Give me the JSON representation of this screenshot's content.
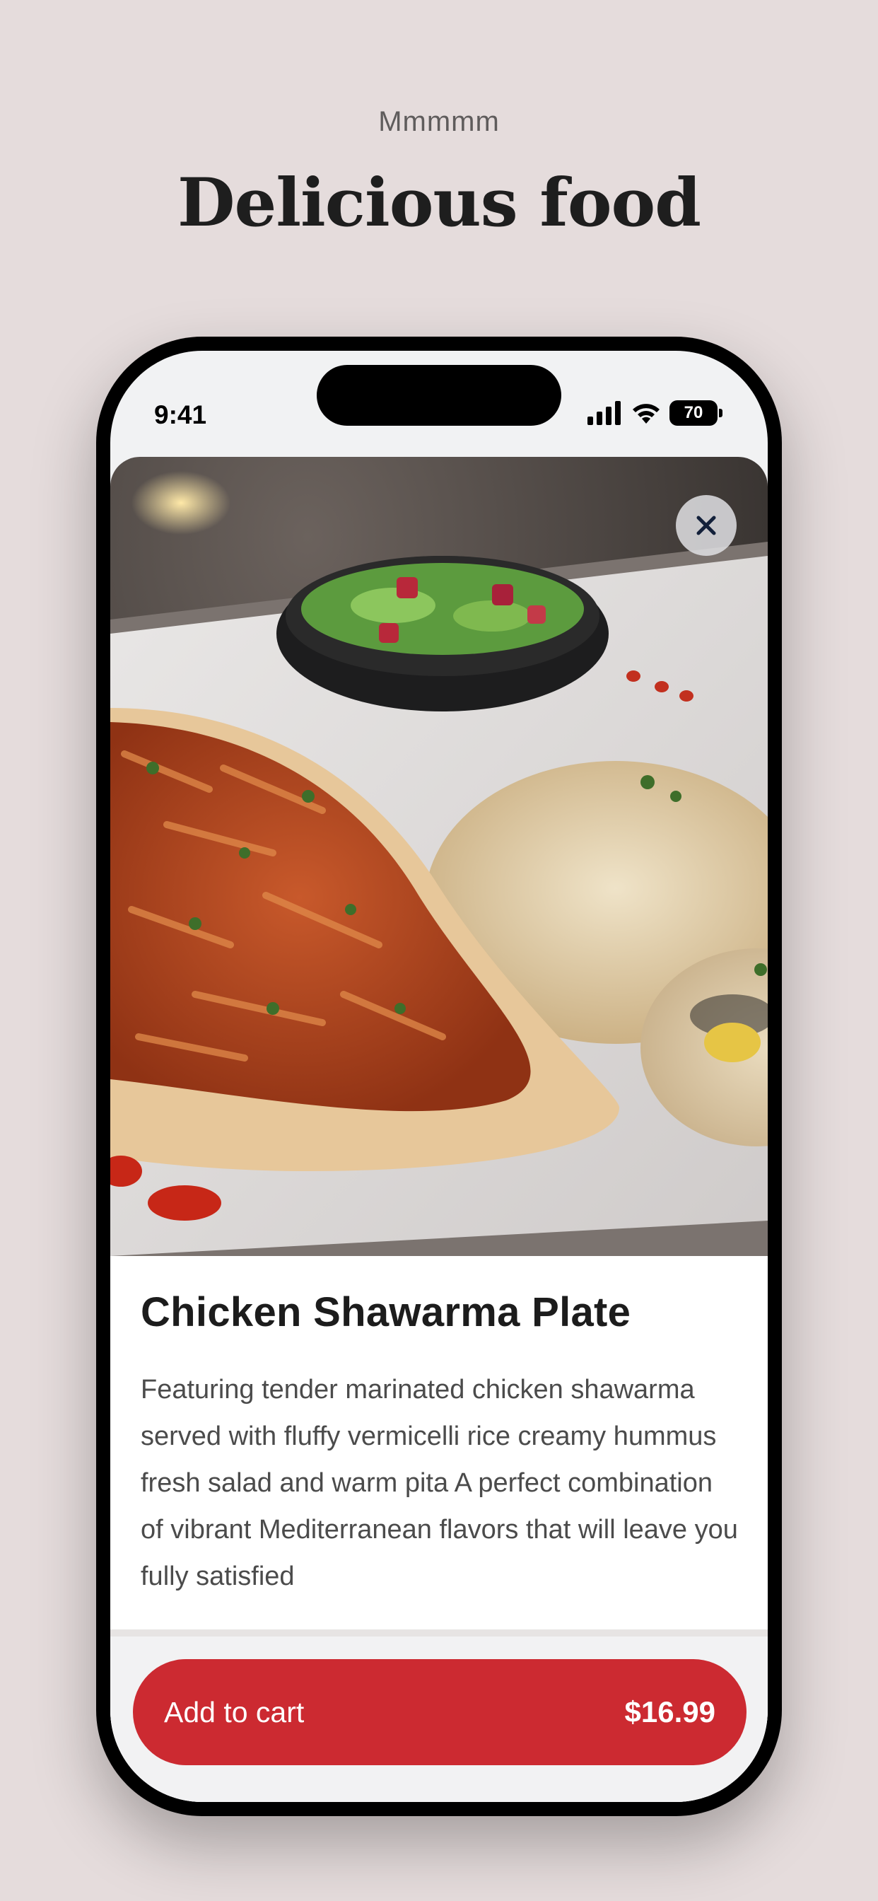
{
  "header": {
    "eyebrow": "Mmmmm",
    "title": "Delicious food"
  },
  "status_bar": {
    "time": "9:41",
    "battery": "70",
    "icons": [
      "cellular-signal-icon",
      "wifi-icon",
      "battery-icon"
    ]
  },
  "product": {
    "image_alt": "food-photo",
    "name": "Chicken Shawarma Plate",
    "description": "Featuring tender marinated chicken shawarma served with fluffy vermicelli rice creamy hummus fresh salad and warm pita A perfect combination of vibrant Mediterranean flavors that will leave you fully satisfied"
  },
  "actions": {
    "close_icon": "close-icon",
    "add_to_cart_label": "Add to cart",
    "price": "$16.99"
  },
  "colors": {
    "background": "#e5dcdc",
    "accent": "#cc2a31",
    "text_primary": "#1c1c1c"
  }
}
